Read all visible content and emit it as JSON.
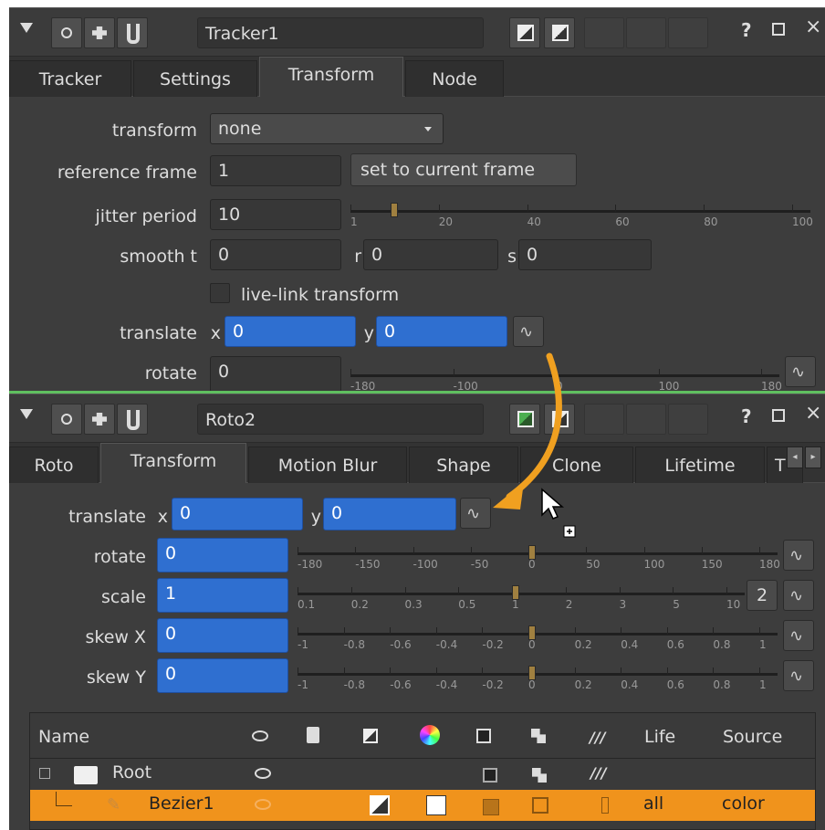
{
  "tracker": {
    "node_name": "Tracker1",
    "tabs": [
      "Tracker",
      "Settings",
      "Transform",
      "Node"
    ],
    "transform_label": "transform",
    "transform_value": "none",
    "ref_label": "reference frame",
    "ref_value": "1",
    "set_current_label": "set to current frame",
    "jitter_label": "jitter period",
    "jitter_value": "10",
    "jitter_slider": {
      "ticks": [
        "1",
        "20",
        "40",
        "60",
        "80",
        "100"
      ],
      "value": 10
    },
    "smooth_label": "smooth t",
    "smooth_t": "0",
    "r_label": "r",
    "smooth_r": "0",
    "s_label": "s",
    "smooth_s": "0",
    "live_link_label": "live-link transform",
    "translate_label": "translate",
    "x_label": "x",
    "translate_x": "0",
    "y_label": "y",
    "translate_y": "0",
    "rotate_label": "rotate",
    "rotate_value": "0",
    "rotate_slider": {
      "ticks": [
        "-180",
        "-100",
        "0",
        "100",
        "180"
      ]
    }
  },
  "roto": {
    "node_name": "Roto2",
    "tabs": [
      "Roto",
      "Transform",
      "Motion Blur",
      "Shape",
      "Clone",
      "Lifetime",
      "T"
    ],
    "translate_label": "translate",
    "x_label": "x",
    "translate_x": "0",
    "y_label": "y",
    "translate_y": "0",
    "rotate_label": "rotate",
    "rotate_value": "0",
    "rotate_slider": {
      "ticks": [
        "-180",
        "-150",
        "-100",
        "-50",
        "0",
        "50",
        "100",
        "150",
        "180"
      ],
      "value": 0
    },
    "scale_label": "scale",
    "scale_value": "1",
    "scale_slider": {
      "ticks": [
        "0.1",
        "0.2",
        "0.3",
        "0.5",
        "1",
        "2",
        "3",
        "5",
        "10"
      ],
      "value": 1
    },
    "scale_badge": "2",
    "skewx_label": "skew X",
    "skewx_value": "0",
    "skewy_label": "skew Y",
    "skewy_value": "0",
    "skew_slider": {
      "ticks": [
        "-1",
        "-0.8",
        "-0.6",
        "-0.4",
        "-0.2",
        "0",
        "0.2",
        "0.4",
        "0.6",
        "0.8",
        "1"
      ],
      "value": 0
    }
  },
  "header_icons": [
    "menu-triangle-icon",
    "viewer-icon",
    "node-icon",
    "wrench-icon"
  ],
  "help_label": "?",
  "table": {
    "columns": [
      "Name",
      "",
      "",
      "",
      "",
      "",
      "",
      "",
      "Life",
      "Source"
    ],
    "rows": [
      {
        "name": "Root",
        "life": "",
        "source": ""
      },
      {
        "name": "Bezier1",
        "life": "all",
        "source": "color"
      }
    ]
  },
  "colors": {
    "selected_row": "#f0931c",
    "accent_arrow": "#f0a020",
    "field_blue": "#2f6fd0"
  }
}
